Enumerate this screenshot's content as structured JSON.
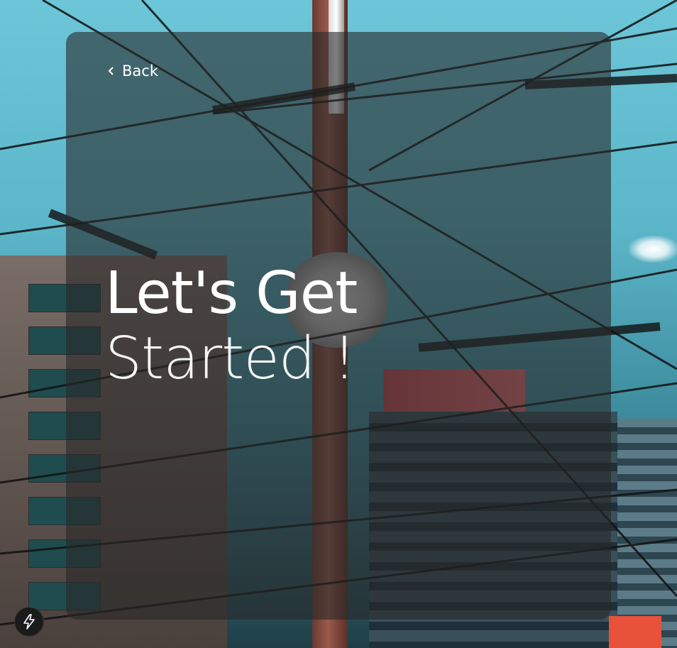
{
  "nav": {
    "back_label": "Back"
  },
  "hero": {
    "line1": "Let's Get",
    "line2": "Started !"
  },
  "icons": {
    "back": "chevron-left-icon",
    "fab": "lightning-bolt-icon"
  },
  "colors": {
    "overlay": "#282828",
    "text": "#ffffff",
    "sky": "#5fb9cc"
  }
}
